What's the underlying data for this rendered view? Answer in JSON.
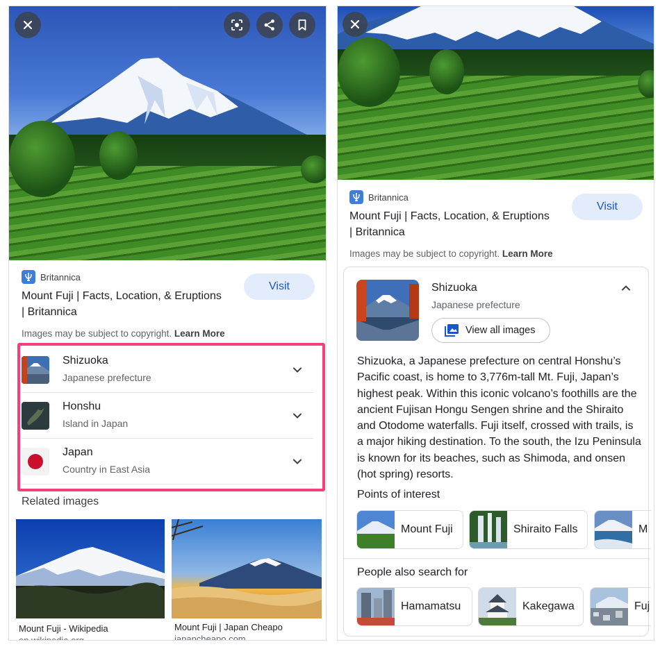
{
  "left_panel": {
    "toolbar": {
      "close_icon": "close-icon",
      "lens_icon": "lens-icon",
      "share_icon": "share-icon",
      "save_icon": "bookmark-icon"
    },
    "source": {
      "name": "Britannica",
      "title_line1": "Mount Fuji | Facts, Location, & Eruptions",
      "title_line2": "| Britannica",
      "visit_label": "Visit"
    },
    "copyright": {
      "text": "Images may be subject to copyright.",
      "link": "Learn More"
    },
    "entities": [
      {
        "name": "Shizuoka",
        "subtitle": "Japanese prefecture"
      },
      {
        "name": "Honshu",
        "subtitle": "Island in Japan"
      },
      {
        "name": "Japan",
        "subtitle": "Country in East Asia"
      }
    ],
    "related": {
      "label": "Related images",
      "items": [
        {
          "caption": "Mount Fuji - Wikipedia",
          "source": "en.wikipedia.org"
        },
        {
          "caption": "Mount Fuji | Japan Cheapo",
          "source": "japancheapo.com"
        }
      ]
    },
    "highlight_color": "#f43f7a"
  },
  "right_panel": {
    "source": {
      "name": "Britannica",
      "title_line1": "Mount Fuji | Facts, Location, & Eruptions",
      "title_line2": "| Britannica",
      "visit_label": "Visit"
    },
    "copyright": {
      "text": "Images may be subject to copyright.",
      "link": "Learn More"
    },
    "detail": {
      "name": "Shizuoka",
      "subtitle": "Japanese prefecture",
      "view_all_label": "View all images",
      "description": "Shizuoka, a Japanese prefecture on central Honshu’s Pacific coast, is home to 3,776m-tall Mt. Fuji, Japan’s highest peak. Within this iconic volcano’s foothills are the ancient Fujisan Hongu Sengen shrine and the Shiraito and Otodome waterfalls. Fuji itself, crossed with trails, is a major hiking destination. To the south, the Izu Peninsula is known for its beaches, such as Shimoda, and onsen (hot spring) resorts.",
      "points_label": "Points of interest",
      "points": [
        "Mount Fuji",
        "Shiraito Falls",
        "M"
      ],
      "people_label": "People also search for",
      "people": [
        "Hamamatsu",
        "Kakegawa",
        "Fuj"
      ]
    }
  },
  "colors": {
    "visit_bg": "#e3ecfb",
    "visit_text": "#1a56c8",
    "britannica_blue": "#3f7ed8"
  }
}
